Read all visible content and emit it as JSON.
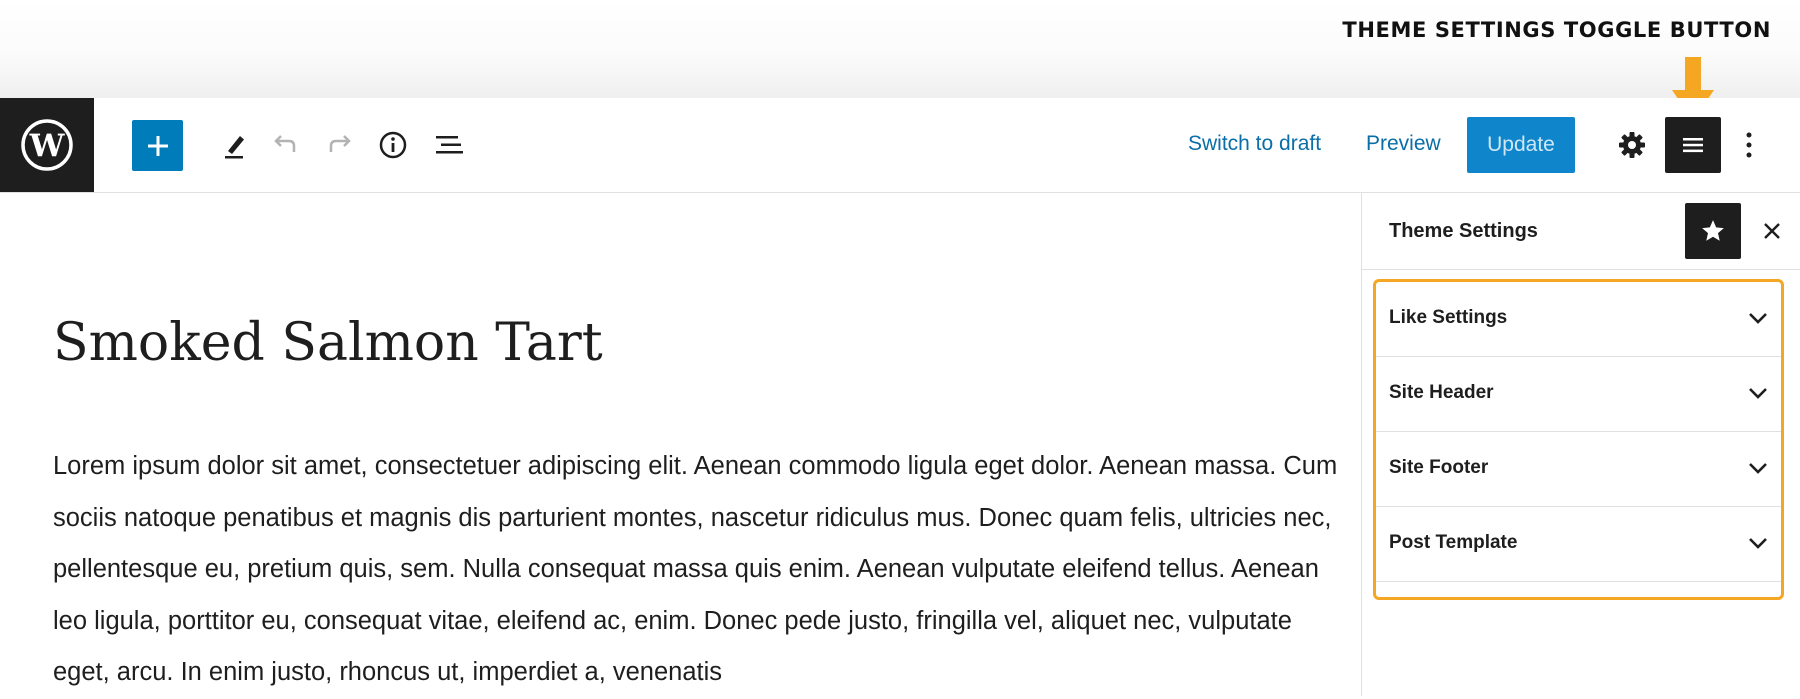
{
  "annotation": {
    "label": "THEME SETTINGS TOGGLE BUTTON",
    "highlight_color": "#f5a623"
  },
  "toolbar": {
    "logo_icon": "wordpress-logo-icon",
    "icons": [
      "plus-icon",
      "pencil-icon",
      "undo-icon",
      "redo-icon",
      "info-icon",
      "list-view-icon",
      "gear-icon",
      "sidebar-menu-icon",
      "more-vertical-icon"
    ],
    "switch_to_draft": "Switch to draft",
    "preview": "Preview",
    "update": "Update",
    "accent_color": "#007cba"
  },
  "post": {
    "title": "Smoked Salmon Tart",
    "body": "Lorem ipsum dolor sit amet, consectetuer adipiscing elit. Aenean commodo ligula eget dolor. Aenean massa. Cum sociis natoque penatibus et magnis dis parturient montes, nascetur ridiculus mus. Donec quam felis, ultricies nec, pellentesque eu, pretium quis, sem. Nulla consequat massa quis enim. Aenean vulputate eleifend tellus. Aenean leo ligula, porttitor eu, consequat vitae, eleifend ac, enim. Donec pede justo, fringilla vel, aliquet nec, vulputate eget, arcu. In enim justo, rhoncus ut, imperdiet a, venenatis"
  },
  "sidebar": {
    "title": "Theme Settings",
    "star_icon": "star-icon",
    "close_icon": "close-icon",
    "panels": [
      {
        "label": "Like Settings"
      },
      {
        "label": "Site Header"
      },
      {
        "label": "Site Footer"
      },
      {
        "label": "Post Template"
      }
    ]
  }
}
